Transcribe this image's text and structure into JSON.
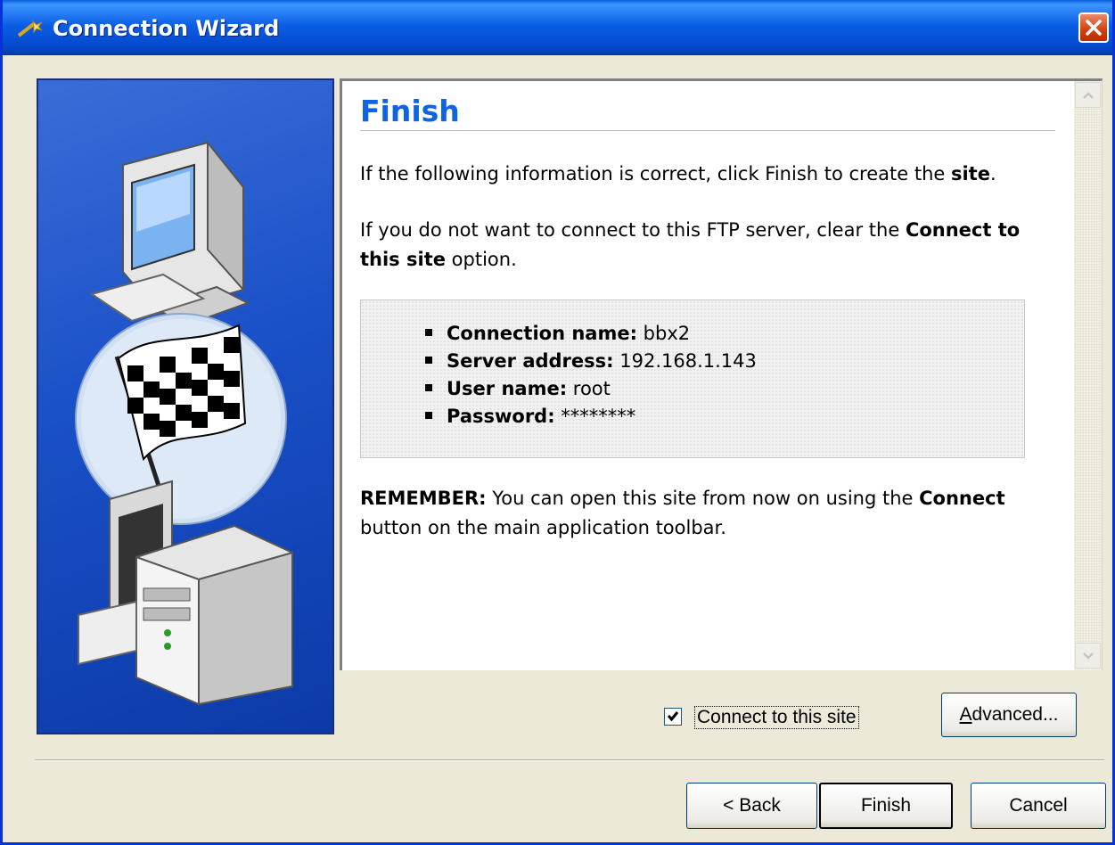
{
  "window": {
    "title": "Connection Wizard",
    "icon": "wizard-wand-icon",
    "close_icon": "close-icon"
  },
  "page": {
    "heading": "Finish",
    "intro_text": "If the following information is correct, click Finish to create the ",
    "intro_bold": "site",
    "intro_end": ".",
    "clear_text_1": "If you do not want to connect to this FTP server, clear the ",
    "clear_bold": "Connect to this site",
    "clear_text_2": " option.",
    "details": [
      {
        "label": "Connection name:",
        "value": " bbx2"
      },
      {
        "label": "Server address:",
        "value": " 192.168.1.143"
      },
      {
        "label": "User name:",
        "value": " root"
      },
      {
        "label": "Password:",
        "value": " ********"
      }
    ],
    "remember_bold": "REMEMBER:",
    "remember_text_1": " You can open this site from now on using the ",
    "remember_connect": "Connect",
    "remember_text_2": " button on the main application toolbar."
  },
  "options": {
    "connect_checked": true,
    "connect_label": "Connect to this site",
    "advanced_label_u": "A",
    "advanced_label_rest": "dvanced..."
  },
  "buttons": {
    "back": "< Back",
    "finish": "Finish",
    "cancel": "Cancel"
  },
  "colors": {
    "title_bar": "#0a5fe5",
    "heading": "#0f64e4",
    "side_panel": "#1a50c8"
  }
}
